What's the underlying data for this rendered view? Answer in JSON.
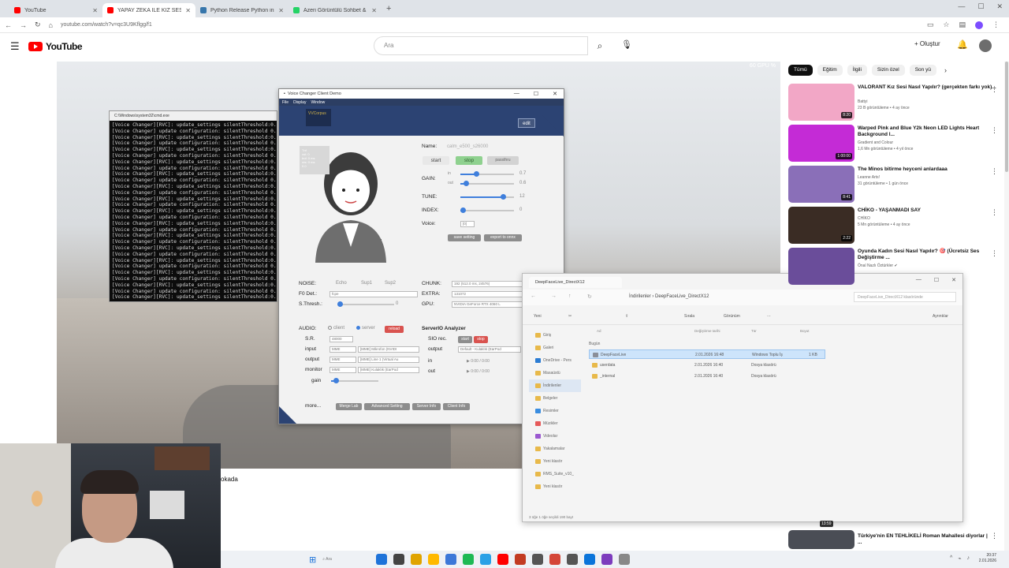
{
  "browser": {
    "tabs": [
      {
        "label": "YouTube",
        "color": "#ff0000"
      },
      {
        "label": "YAPAY ZEKA İLE KIZ SESİ NASIL",
        "color": "#ff0000"
      },
      {
        "label": "Python Release Python insta...",
        "color": "#3776ab"
      },
      {
        "label": "Azeri Görüntülü Sohbet &",
        "color": "#25d366"
      }
    ],
    "new_tab": "+",
    "url": "youtube.com/watch?v=qc3U9Kflgg/f1"
  },
  "youtube": {
    "logo": "YouTube",
    "search_placeholder": "Ara",
    "create": "+ Oluştur",
    "chips": [
      "Tümü",
      "Eğitim",
      "İlgili",
      "Sizin özel",
      "Son yü"
    ],
    "video_title": "okada",
    "fps_overlay": "60 GPU %"
  },
  "console": {
    "title": "C:\\Windows\\system32\\cmd.exe",
    "lines": [
      "[Voice Changer][RVC]: update_settings silentThreshold:0.",
      "[Voice Changer] update configuration: silentThreshold 0.",
      "[Voice Changer][RVC]: update_settings silentThreshold:0.",
      "[Voice Changer] update configuration: silentThreshold 0.",
      "[Voice Changer][RVC]: update_settings silentThreshold:0.",
      "[Voice Changer] update configuration: silentThreshold 0.",
      "[Voice Changer][RVC]: update_settings silentThreshold:0.",
      "[Voice Changer] update configuration: silentThreshold 0.",
      "[Voice Changer][RVC]: update_settings silentThreshold:0.",
      "[Voice Changer] update configuration: silentThreshold 0.",
      "[Voice Changer][RVC]: update_settings silentThreshold:0.",
      "[Voice Changer] update configuration: silentThreshold 0.",
      "[Voice Changer][RVC]: update_settings silentThreshold:0.",
      "[Voice Changer] update configuration: silentThreshold 0.",
      "[Voice Changer][RVC]: update_settings silentThreshold:0.",
      "[Voice Changer] update configuration: silentThreshold 0.",
      "[Voice Changer][RVC]: update_settings silentThreshold:0.",
      "[Voice Changer] update configuration: silentThreshold 0.",
      "[Voice Changer][RVC]: update_settings silentThreshold:0.",
      "[Voice Changer] update configuration: silentThreshold 0.",
      "[Voice Changer][RVC]: update_settings silentThreshold:0.",
      "[Voice Changer] update configuration: silentThreshold 0.",
      "[Voice Changer][RVC]: update_settings silentThreshold:0.",
      "[Voice Changer] update configuration: silentThreshold 0.",
      "[Voice Changer][RVC]: update_settings silentThreshold:0.",
      "[Voice Changer] update configuration: silentThreshold 0.",
      "[Voice Changer][RVC]: update_settings silentThreshold:0.",
      "[Voice Changer] update configuration: silentThreshold 0.",
      "[Voice Changer][RVC]: update_settings silentThreshold:0."
    ]
  },
  "voice_changer": {
    "title": "Voice Changer Client Demo",
    "menu": [
      "File",
      "Display",
      "Window"
    ],
    "logo_text": "VVCorpus",
    "edit": "edit",
    "name_label": "Name:",
    "name_value": "calm_e500_s26000",
    "start": "start",
    "stop": "stop",
    "passthru": "passthru",
    "gain_label": "GAIN:",
    "gain_in_label": "in",
    "gain_in_value": "0.7",
    "gain_in_level": 0.3,
    "gain_out_label": "out",
    "gain_out_value": "0.6",
    "gain_out_level": 0.1,
    "tune_label": "TUNE:",
    "tune_value": "12",
    "tune_level": 0.8,
    "index_label": "INDEX:",
    "index_value": "0",
    "index_level": 0.05,
    "voice_label": "Voice:",
    "voice_value": "[0]",
    "save_setting": "save setting",
    "export_onnx": "export to onnx",
    "noise_label": "NOISE:",
    "noise_opts": [
      "Echo",
      "Sup1",
      "Sup2"
    ],
    "f0_label": "F0 Det.:",
    "f0_value": "fcpe",
    "sthresh_label": "S.Thresh.:",
    "sthresh_value": "0",
    "chunk_label": "CHUNK:",
    "chunk_value": "192 (512.0 ms, 24576)",
    "extra_label": "EXTRA:",
    "extra_value": "131072",
    "gpu_label": "GPU:",
    "gpu_value": "NVIDIA GeForce RTX 4060 L",
    "audio_label": "AUDIO:",
    "audio_client": "client",
    "audio_server": "server",
    "reload": "reload",
    "sr_label": "S.R.",
    "sr_value": "48000",
    "input_label": "input",
    "input_api": "MME",
    "input_dev": "[MME] Mikrofon (NVIDI",
    "output_label": "output",
    "output_api": "MME",
    "output_dev": "[MME] Line 1 (Virtual Au",
    "monitor_label": "monitor",
    "monitor_api": "MME",
    "monitor_dev": "[MME] Kulaklık (EarPod",
    "gain_label2": "gain",
    "gain2_level": 0.1,
    "analyzer_title": "ServerIO Analyzer",
    "sio_label": "SIO rec.",
    "sio_start": "start",
    "sio_stop": "stop",
    "an_output_label": "output",
    "an_output_value": "Default - Kulaklık (EarPod",
    "an_in_label": "in",
    "an_in_time": "0:00 / 0:00",
    "an_out_label": "out",
    "an_out_time": "0:00 / 0:00",
    "more": "more...",
    "more_buttons": [
      "Merge Lab",
      "Advanced Setting",
      "Server Info",
      "Client Info"
    ],
    "mini_info": [
      "Tnf",
      "vol: 0",
      "buf: 0 ms",
      "res: 0 ms",
      "0.0"
    ]
  },
  "explorer": {
    "tab_title": "DeepFaceLive_DirectX12",
    "breadcrumb": [
      "İndirilenler",
      "DeepFaceLive_DirectX12"
    ],
    "search_placeholder": "DeepFaceLive_DirectX12 klasöründe",
    "toolbar": [
      "Yeni",
      "Sırala",
      "Görünüm",
      "Ayrıntılar"
    ],
    "columns": [
      "Ad",
      "Değiştirme tarihi",
      "Tür",
      "Boyut"
    ],
    "group": "Bugün",
    "files": [
      {
        "name": "DeepFaceLive",
        "date": "2.01.2026 16:48",
        "type": "Windows Toplu İş",
        "size": "1 KB",
        "selected": true
      },
      {
        "name": "userdata",
        "date": "2.01.2026 16:40",
        "type": "Dosya klasörü",
        "size": "",
        "selected": false
      },
      {
        "name": "_internal",
        "date": "2.01.2026 16:40",
        "type": "Dosya klasörü",
        "size": "",
        "selected": false
      }
    ],
    "sidebar": [
      "Giriş",
      "Galeri",
      "OneDrive - Pers",
      "Masaüstü",
      "İndirilenler",
      "Belgeler",
      "Resimler",
      "Müzikler",
      "Videolar",
      "Yakalamalar",
      "Yeni klasör",
      "RMS_Suite_v10_",
      "Yeni klasör"
    ],
    "status": "3 öğe   1 öğe seçildi  190 bayt"
  },
  "recommendations": [
    {
      "title": "VALORANT Kız Sesi Nasıl Yapılır? (gerçekten farkı yok)...",
      "channel": "Battyi",
      "meta": "23 B görüntüleme • 4 ay önce",
      "duration": "8:20",
      "color": "#f2a7c6"
    },
    {
      "title": "Warped Pink and Blue Y2k Neon LED Lights Heart Background l...",
      "channel": "Gradient and Colour",
      "meta": "1,6 Mn görüntüleme • 4 yıl önce",
      "duration": "1:00:00",
      "color": "#c42bd6"
    },
    {
      "title": "The Minos bitirme heyceni anlardaaa",
      "channel": "Leanne Arts!",
      "meta": "31 görüntüleme • 1 gün önce",
      "duration": "8:41",
      "color": "#8a6fb8"
    },
    {
      "title": "CHİKO - YAŞANMADI SAY",
      "channel": "CHİKO",
      "meta": "5 Mn görüntüleme • 4 ay önce",
      "duration": "2:22",
      "color": "#3a2c24"
    },
    {
      "title": "Oyunda Kadın Sesi Nasıl Yapılır? 🎯 (Ücretsiz Ses Değiştirme ...",
      "channel": "Önal Nazlı Öztürkler ✔",
      "meta": "",
      "duration": "",
      "color": "#6a4d9a"
    }
  ],
  "bottom_rec": {
    "title": "Türkiye'nin EN TEHLİKELİ Roman Mahallesi diyorlar | ...",
    "duration": "13:59"
  },
  "taskbar": {
    "search": "Ara",
    "time": "20:37",
    "date": "2.01.2026",
    "icon_colors": [
      "#1e73d9",
      "#444444",
      "#e0a400",
      "#ffb900",
      "#3c78d8",
      "#1db954",
      "#2aa1e6",
      "#ff0000",
      "#c23b22",
      "#555555",
      "#d44638",
      "#555555",
      "#0a74da",
      "#7d3cbd",
      "#888888"
    ]
  }
}
